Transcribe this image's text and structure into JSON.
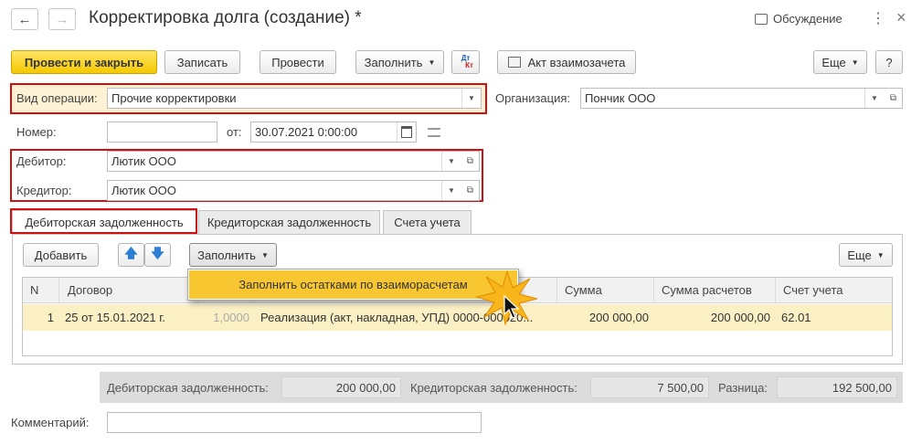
{
  "window": {
    "title": "Корректировка долга (создание) *",
    "discussion_label": "Обсуждение"
  },
  "toolbar": {
    "post_close": "Провести и закрыть",
    "save": "Записать",
    "post": "Провести",
    "fill": "Заполнить",
    "dt": "Дт",
    "kt": "Кт",
    "act": "Акт взаимозачета",
    "more": "Еще",
    "help": "?"
  },
  "form": {
    "operation_label": "Вид операции:",
    "operation_value": "Прочие корректировки",
    "org_label": "Организация:",
    "org_value": "Пончик ООО",
    "number_label": "Номер:",
    "number_value": "",
    "date_label": "от:",
    "date_value": "30.07.2021  0:00:00",
    "debtor_label": "Дебитор:",
    "debtor_value": "Лютик ООО",
    "creditor_label": "Кредитор:",
    "creditor_value": "Лютик ООО",
    "comment_label": "Комментарий:",
    "comment_value": ""
  },
  "tabs": [
    {
      "label": "Дебиторская задолженность"
    },
    {
      "label": "Кредиторская задолженность"
    },
    {
      "label": "Счета учета"
    }
  ],
  "table_toolbar": {
    "add": "Добавить",
    "fill": "Заполнить",
    "more": "Еще"
  },
  "dropdown": {
    "item": "Заполнить остатками по взаиморасчетам"
  },
  "table": {
    "columns": [
      "N",
      "Договор",
      "Сумма",
      "Сумма расчетов",
      "Счет учета"
    ],
    "rows": [
      {
        "n": "1",
        "contract": "25 от 15.01.2021 г.",
        "rate": "1,0000",
        "doc": "Реализация (акт, накладная, УПД) 0000-000020...",
        "sum": "200 000,00",
        "sum_calc": "200 000,00",
        "account": "62.01"
      }
    ]
  },
  "totals": {
    "debit_label": "Дебиторская задолженность:",
    "debit_value": "200 000,00",
    "credit_label": "Кредиторская задолженность:",
    "credit_value": "7 500,00",
    "diff_label": "Разница:",
    "diff_value": "192 500,00"
  },
  "colors": {
    "highlight": "#d01010",
    "primary_button": "#f5c900",
    "selected_row": "#fbf0c4",
    "menu_item": "#f7c630"
  }
}
